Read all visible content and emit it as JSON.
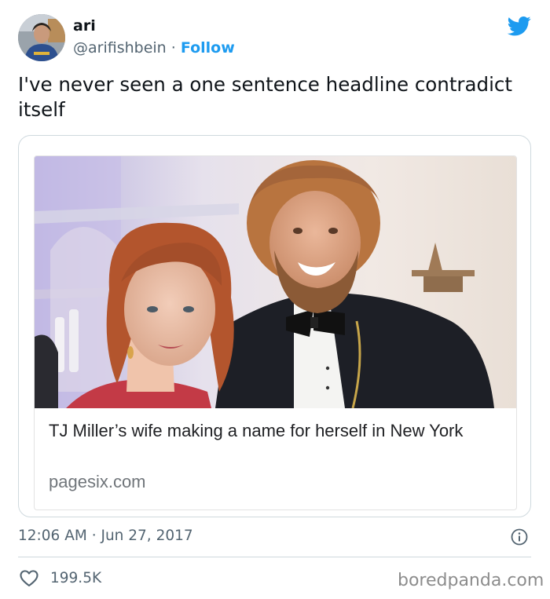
{
  "author": {
    "display_name": "ari",
    "handle": "@arifishbein",
    "separator": "·",
    "follow_label": "Follow"
  },
  "tweet": {
    "text": "I've never seen a one sentence headline contradict itself"
  },
  "link_card": {
    "headline": "TJ Miller’s wife making a name for herself in New York",
    "domain": "pagesix.com"
  },
  "meta": {
    "time": "12:06 AM",
    "separator": "·",
    "date": "Jun 27, 2017"
  },
  "engagement": {
    "likes": "199.5K"
  },
  "watermark": "boredpanda.com",
  "icons": {
    "brand": "twitter-bird-icon",
    "info": "info-icon",
    "like": "heart-icon"
  },
  "colors": {
    "accent": "#1d9bf0",
    "text_primary": "#0f1419",
    "text_secondary": "#536471",
    "border": "#cfd9de"
  }
}
